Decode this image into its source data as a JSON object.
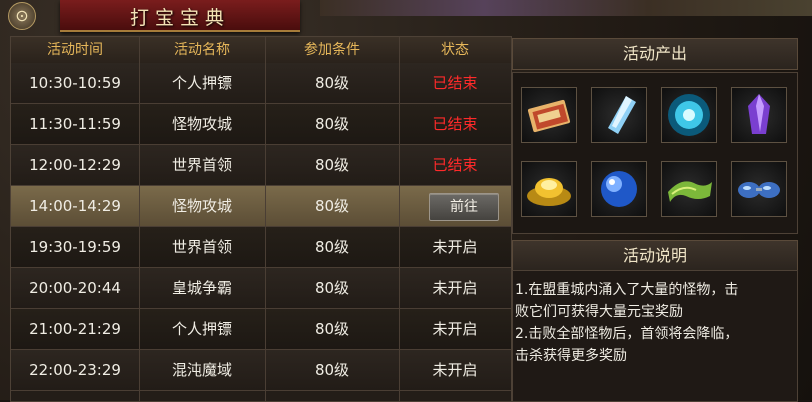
{
  "window": {
    "title": "打宝宝典",
    "close_glyph": "⊙"
  },
  "table": {
    "headers": [
      "活动时间",
      "活动名称",
      "参加条件",
      "状态"
    ],
    "rows": [
      {
        "time": "10:30-10:59",
        "name": "个人押镖",
        "condition": "80级",
        "status": "已结束"
      },
      {
        "time": "11:30-11:59",
        "name": "怪物攻城",
        "condition": "80级",
        "status": "已结束"
      },
      {
        "time": "12:00-12:29",
        "name": "世界首领",
        "condition": "80级",
        "status": "已结束"
      },
      {
        "time": "14:00-14:29",
        "name": "怪物攻城",
        "condition": "80级",
        "status": "前往"
      },
      {
        "time": "19:30-19:59",
        "name": "世界首领",
        "condition": "80级",
        "status": "未开启"
      },
      {
        "time": "20:00-20:44",
        "name": "皇城争霸",
        "condition": "80级",
        "status": "未开启"
      },
      {
        "time": "21:00-21:29",
        "name": "个人押镖",
        "condition": "80级",
        "status": "未开启"
      },
      {
        "time": "22:00-23:29",
        "name": "混沌魔域",
        "condition": "80级",
        "status": "未开启"
      }
    ]
  },
  "rewards": {
    "title": "活动产出",
    "items": [
      "scroll-tickets-icon",
      "blue-crystal-icon",
      "glowing-orb-icon",
      "purple-crystal-icon",
      "gold-ingot-icon",
      "blue-sphere-icon",
      "green-scroll-icon",
      "goggles-icon"
    ]
  },
  "description": {
    "title": "活动说明",
    "lines": [
      "1.在盟重城内涌入了大量的怪物，击",
      "败它们可获得大量元宝奖励",
      "2.击败全部怪物后，首领将会降临，",
      "击杀获得更多奖励"
    ]
  },
  "colors": {
    "ended": "#ff2a2a",
    "header": "#e6b75a",
    "highlight_row": "#7a6a4a"
  }
}
